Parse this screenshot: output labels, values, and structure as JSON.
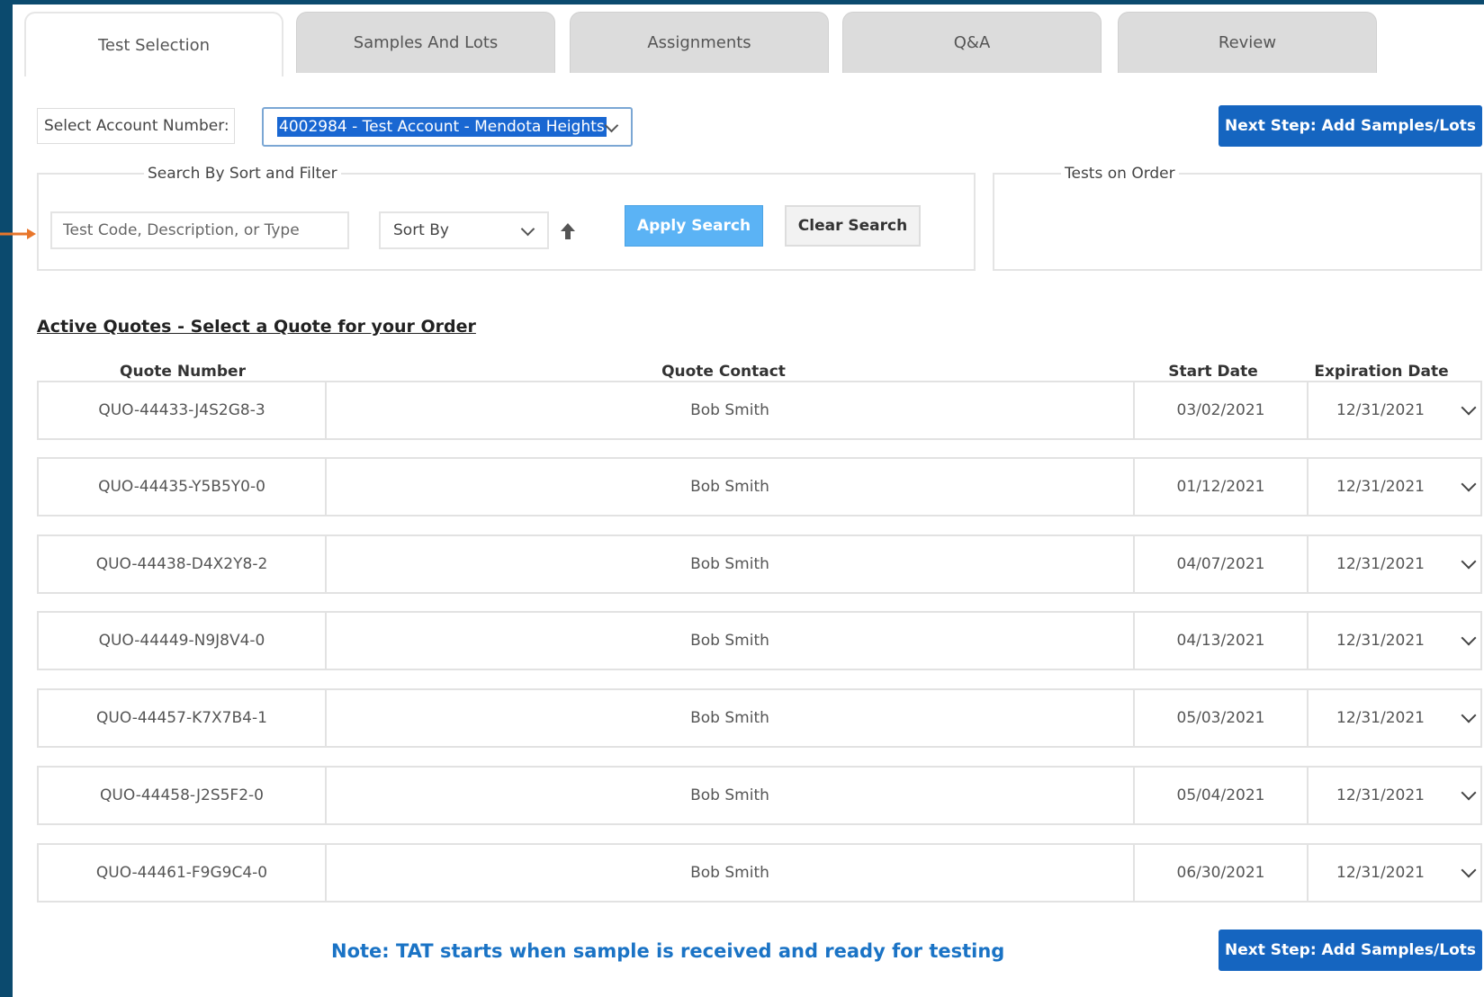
{
  "tabs": [
    {
      "label": "Test Selection"
    },
    {
      "label": "Samples And Lots"
    },
    {
      "label": "Assignments"
    },
    {
      "label": "Q&A"
    },
    {
      "label": "Review"
    }
  ],
  "account": {
    "label": "Select Account Number:",
    "selected": "4002984 - Test Account - Mendota Heights"
  },
  "next_step_label": "Next Step: Add Samples/Lots",
  "search": {
    "legend": "Search By Sort and Filter",
    "placeholder": "Test Code, Description, or Type",
    "sort_label": "Sort By",
    "apply_label": "Apply Search",
    "clear_label": "Clear Search"
  },
  "tests_on_order": {
    "legend": "Tests on Order"
  },
  "quotes": {
    "title": "Active Quotes - Select a Quote for your Order",
    "headers": {
      "number": "Quote Number",
      "contact": "Quote Contact",
      "start": "Start Date",
      "expiration": "Expiration Date"
    },
    "rows": [
      {
        "number": "QUO-44433-J4S2G8-3",
        "contact": "Bob Smith",
        "start": "03/02/2021",
        "expiration": "12/31/2021"
      },
      {
        "number": "QUO-44435-Y5B5Y0-0",
        "contact": "Bob Smith",
        "start": "01/12/2021",
        "expiration": "12/31/2021"
      },
      {
        "number": "QUO-44438-D4X2Y8-2",
        "contact": "Bob Smith",
        "start": "04/07/2021",
        "expiration": "12/31/2021"
      },
      {
        "number": "QUO-44449-N9J8V4-0",
        "contact": "Bob Smith",
        "start": "04/13/2021",
        "expiration": "12/31/2021"
      },
      {
        "number": "QUO-44457-K7X7B4-1",
        "contact": "Bob Smith",
        "start": "05/03/2021",
        "expiration": "12/31/2021"
      },
      {
        "number": "QUO-44458-J2S5F2-0",
        "contact": "Bob Smith",
        "start": "05/04/2021",
        "expiration": "12/31/2021"
      },
      {
        "number": "QUO-44461-F9G9C4-0",
        "contact": "Bob Smith",
        "start": "06/30/2021",
        "expiration": "12/31/2021"
      }
    ]
  },
  "note": "Note: TAT starts when sample is received and ready for testing",
  "colors": {
    "primary": "#1565c0",
    "apply": "#5bb3f5",
    "frame": "#0b4a6e",
    "arrow": "#e8762b",
    "note": "#1a73c5"
  },
  "icons": {
    "dropdown": "chevron-down-icon",
    "sort_direction": "arrow-up-icon",
    "pointer": "arrow-right-icon",
    "row_expand": "chevron-down-icon"
  }
}
